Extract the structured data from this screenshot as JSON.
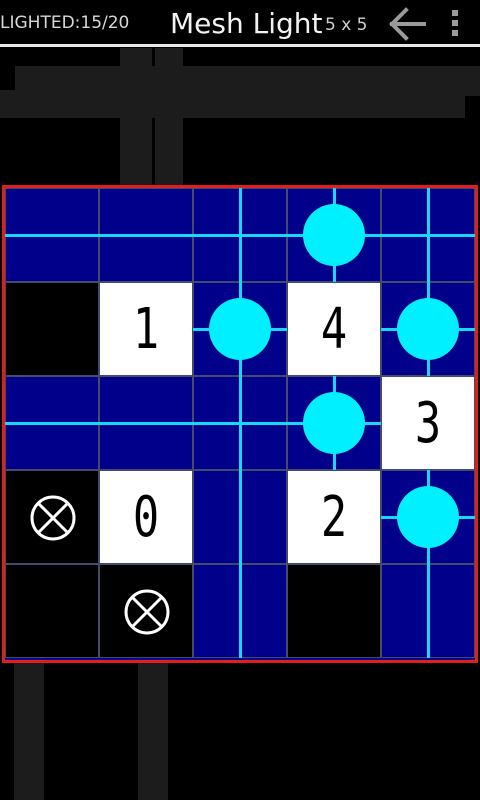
{
  "header": {
    "lighted_label": "LIGHTED:15/20",
    "title": "Mesh Light",
    "size_label": "5 x 5",
    "back_icon": "back-arrow-icon",
    "menu_icon": "overflow-menu-icon"
  },
  "colors": {
    "background": "#000000",
    "lit_cell": "#00008a",
    "beam": "#19d8ff",
    "bulb": "#00f0ff",
    "border": "#e11d1d",
    "wall": "#ffffff"
  },
  "board": {
    "rows": 5,
    "cols": 5,
    "cells": [
      [
        "lit",
        "lit",
        "lit",
        "bulb",
        "lit"
      ],
      [
        "dark",
        "1",
        "bulb",
        "4",
        "bulb"
      ],
      [
        "lit",
        "lit",
        "lit",
        "bulb",
        "3"
      ],
      [
        "x",
        "0",
        "lit",
        "2",
        "bulb"
      ],
      [
        "dark",
        "x",
        "lit",
        "dark",
        "lit"
      ]
    ]
  }
}
